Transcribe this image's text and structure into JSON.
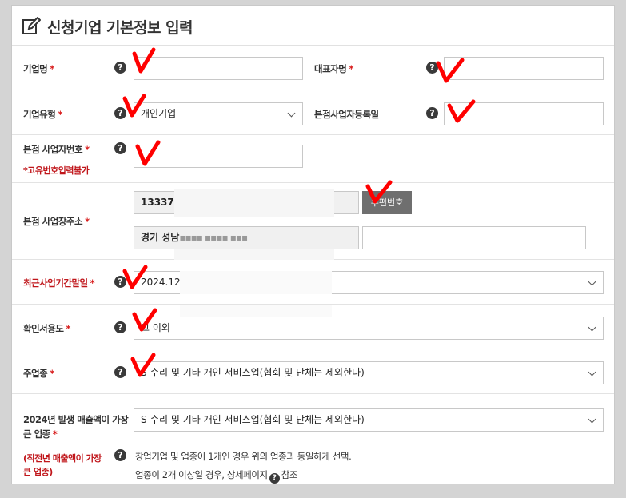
{
  "header": {
    "title": "신청기업 기본정보 입력"
  },
  "required_mark": "*",
  "help_glyph": "?",
  "rows": {
    "company_name": {
      "label": "기업명",
      "value": ""
    },
    "ceo_name": {
      "label": "대표자명",
      "value": ""
    },
    "company_type": {
      "label": "기업유형",
      "value": "개인기업"
    },
    "hq_reg_date": {
      "label": "본점사업자등록일",
      "value": ""
    },
    "hq_biz_no": {
      "label": "본점 사업자번호",
      "note": "*고유번호입력불가",
      "value": ""
    },
    "hq_address": {
      "label": "본점 사업장주소",
      "zipcode": "13337",
      "zip_button": "우편번호",
      "address1": "경기 성남",
      "address1_masked": "▪▪▪▪ ▪▪▪▪ ▪▪▪",
      "address2": ""
    },
    "fiscal_end": {
      "label": "최근사업기간말일",
      "value": "2024.12."
    },
    "cert_use": {
      "label": "확인서용도",
      "value": "그 이외"
    },
    "main_industry": {
      "label": "주업종",
      "value": "S-수리 및 기타 개인 서비스업(협회 및 단체는 제외한다)"
    },
    "top_sales_industry": {
      "label_line1": "2024년 발생 매출액이 가장",
      "label_line2": "큰 업종",
      "note_line1": "(직전년 매출액이 가장",
      "note_line2": "큰 업종)",
      "value": "S-수리 및 기타 개인 서비스업(협회 및 단체는 제외한다)",
      "info_line1": "창업기업 및 업종이 1개인 경우 위의 업종과 동일하게 선택.",
      "info_line2_before": "업종이 2개 이상일 경우, 상세페이지",
      "info_line2_after": "참조"
    }
  },
  "colors": {
    "required": "#d81c1c",
    "check_mark": "#ff0000",
    "help_bg": "#3a3a3a"
  }
}
